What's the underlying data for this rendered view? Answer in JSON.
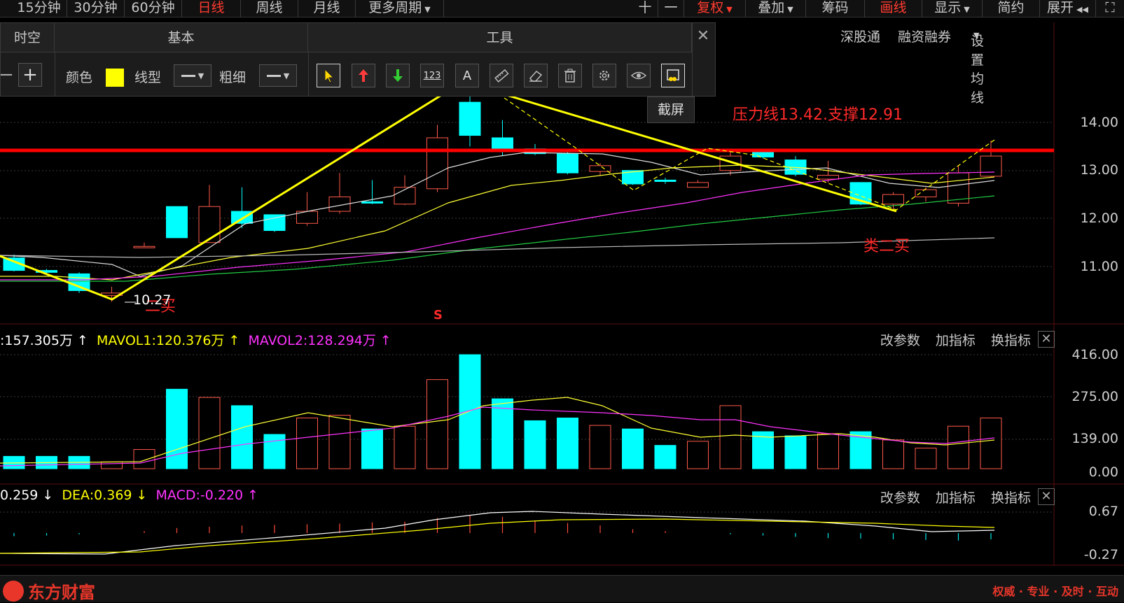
{
  "topbar": {
    "periods": [
      "15分钟",
      "30分钟",
      "60分钟",
      "日线",
      "周线",
      "月线",
      "更多周期"
    ],
    "active_period": "日线",
    "right": [
      "十",
      "一",
      "复权",
      "叠加",
      "筹码",
      "画线",
      "显示",
      "简约",
      "展开"
    ]
  },
  "subbar": {
    "items": [
      "深股通",
      "融资融券",
      "设置均线"
    ]
  },
  "toolbar": {
    "section_timespace": "时空",
    "section_basic": "基本",
    "section_tools": "工具",
    "color_label": "颜色",
    "color_value": "#ffff00",
    "linetype_label": "线型",
    "thickness_label": "粗细",
    "tool_123": "123",
    "tool_text": "A",
    "tooltip": "截屏",
    "close": "✕",
    "tool_icons": [
      "cursor-icon",
      "up-arrow-icon",
      "down-arrow-icon",
      "measure-123-icon",
      "text-icon",
      "ruler-icon",
      "eraser-icon",
      "trash-icon",
      "gear-icon",
      "eye-icon",
      "screenshot-icon"
    ]
  },
  "price_panel": {
    "axis": [
      "14.00",
      "13.00",
      "12.00",
      "11.00"
    ],
    "annotation_main": "压力线13.42.支撑12.91",
    "annotation_buy2": "类二买",
    "annotation_low": "10.27",
    "annotation_buy": "二买",
    "annotation_s": "S",
    "resistance": 13.42,
    "support": 12.91
  },
  "volume_panel": {
    "labels": [
      {
        "text": ":157.305万 ↑",
        "color": "#ffffff"
      },
      {
        "text": "MAVOL1:120.376万 ↑",
        "color": "#ffff00"
      },
      {
        "text": "MAVOL2:128.294万 ↑",
        "color": "#ff33ff"
      }
    ],
    "axis": [
      "416.00",
      "275.00",
      "139.00",
      "0.00"
    ],
    "actions": [
      "改参数",
      "加指标",
      "换指标"
    ]
  },
  "macd_panel": {
    "labels": [
      {
        "text": "0.259 ↓",
        "color": "#ffffff"
      },
      {
        "text": "DEA:0.369 ↓",
        "color": "#ffff00"
      },
      {
        "text": "MACD:-0.220 ↑",
        "color": "#ff33ff"
      }
    ],
    "axis": [
      "0.67",
      "-0.27"
    ],
    "actions": [
      "改参数",
      "加指标",
      "换指标"
    ]
  },
  "footer": {
    "brand": "东方财富",
    "slogan": "权威 · 专业 · 及时 · 互动"
  },
  "chart_data": {
    "type": "candlestick",
    "price_ylim": [
      10.0,
      14.5
    ],
    "candles": [
      {
        "o": 11.18,
        "h": 11.25,
        "l": 10.9,
        "c": 10.92,
        "up": false
      },
      {
        "o": 10.92,
        "h": 10.95,
        "l": 10.85,
        "c": 10.88,
        "up": false
      },
      {
        "o": 10.85,
        "h": 10.88,
        "l": 10.45,
        "c": 10.5,
        "up": false
      },
      {
        "o": 10.4,
        "h": 10.58,
        "l": 10.27,
        "c": 10.45,
        "up": true
      },
      {
        "o": 11.4,
        "h": 11.5,
        "l": 11.4,
        "c": 11.42,
        "up": true
      },
      {
        "o": 12.25,
        "h": 12.25,
        "l": 11.6,
        "c": 11.6,
        "up": false
      },
      {
        "o": 11.5,
        "h": 12.7,
        "l": 11.5,
        "c": 12.25,
        "up": true
      },
      {
        "o": 12.15,
        "h": 12.65,
        "l": 11.8,
        "c": 11.9,
        "up": false
      },
      {
        "o": 12.08,
        "h": 12.08,
        "l": 11.72,
        "c": 11.75,
        "up": false
      },
      {
        "o": 11.9,
        "h": 12.55,
        "l": 11.85,
        "c": 12.15,
        "up": true
      },
      {
        "o": 12.15,
        "h": 12.95,
        "l": 12.1,
        "c": 12.45,
        "up": true
      },
      {
        "o": 12.35,
        "h": 12.8,
        "l": 12.3,
        "c": 12.32,
        "up": false
      },
      {
        "o": 12.3,
        "h": 12.9,
        "l": 12.28,
        "c": 12.65,
        "up": true
      },
      {
        "o": 12.62,
        "h": 13.95,
        "l": 12.55,
        "c": 13.68,
        "up": true
      },
      {
        "o": 14.42,
        "h": 14.55,
        "l": 13.5,
        "c": 13.73,
        "up": false
      },
      {
        "o": 13.68,
        "h": 14.05,
        "l": 13.3,
        "c": 13.45,
        "up": false
      },
      {
        "o": 13.45,
        "h": 13.55,
        "l": 13.32,
        "c": 13.35,
        "up": false
      },
      {
        "o": 13.35,
        "h": 13.45,
        "l": 12.92,
        "c": 12.95,
        "up": false
      },
      {
        "o": 12.98,
        "h": 13.15,
        "l": 12.9,
        "c": 13.1,
        "up": true
      },
      {
        "o": 13.0,
        "h": 13.0,
        "l": 12.7,
        "c": 12.72,
        "up": false
      },
      {
        "o": 12.8,
        "h": 12.85,
        "l": 12.72,
        "c": 12.78,
        "up": false
      },
      {
        "o": 12.65,
        "h": 12.8,
        "l": 12.65,
        "c": 12.75,
        "up": true
      },
      {
        "o": 13.0,
        "h": 13.4,
        "l": 12.9,
        "c": 13.3,
        "up": true
      },
      {
        "o": 13.38,
        "h": 13.45,
        "l": 13.25,
        "c": 13.28,
        "up": false
      },
      {
        "o": 13.22,
        "h": 13.3,
        "l": 12.88,
        "c": 12.92,
        "up": false
      },
      {
        "o": 12.82,
        "h": 13.2,
        "l": 12.75,
        "c": 12.9,
        "up": true
      },
      {
        "o": 12.75,
        "h": 12.75,
        "l": 12.28,
        "c": 12.3,
        "up": false
      },
      {
        "o": 12.3,
        "h": 12.55,
        "l": 12.15,
        "c": 12.5,
        "up": true
      },
      {
        "o": 12.45,
        "h": 12.65,
        "l": 12.35,
        "c": 12.6,
        "up": true
      },
      {
        "o": 12.32,
        "h": 13.1,
        "l": 12.25,
        "c": 12.95,
        "up": true
      },
      {
        "o": 12.88,
        "h": 13.62,
        "l": 12.85,
        "c": 13.3,
        "up": true
      }
    ],
    "volume_ylim": [
      0,
      416
    ],
    "volumes": [
      45,
      45,
      45,
      25,
      70,
      290,
      260,
      230,
      125,
      185,
      195,
      145,
      155,
      325,
      416,
      255,
      175,
      185,
      158,
      145,
      85,
      100,
      230,
      135,
      120,
      128,
      135,
      105,
      75,
      155,
      185
    ],
    "macd_bars": [
      -0.05,
      -0.04,
      -0.02,
      0.0,
      0.03,
      0.08,
      0.1,
      0.12,
      0.13,
      0.14,
      0.15,
      0.17,
      0.18,
      0.24,
      0.28,
      0.26,
      0.2,
      0.16,
      0.12,
      0.06,
      0.03,
      0.0,
      -0.02,
      -0.04,
      -0.06,
      -0.08,
      -0.09,
      -0.1,
      -0.11,
      -0.12,
      -0.1
    ]
  }
}
